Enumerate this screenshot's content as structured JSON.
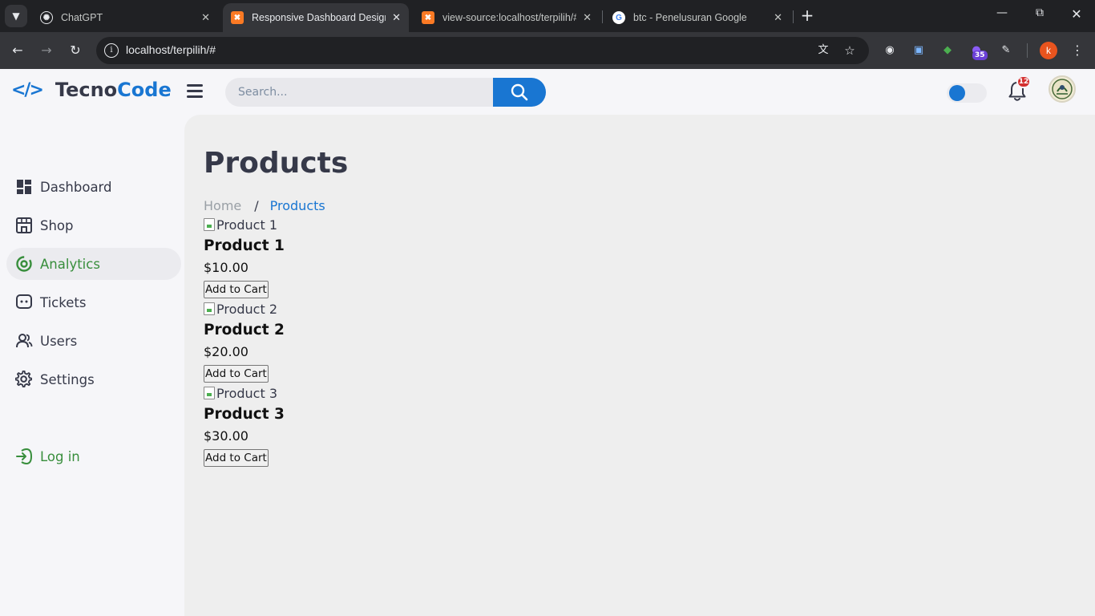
{
  "browser": {
    "tabs": [
      {
        "title": "ChatGPT",
        "icon": "chatgpt-icon",
        "active": false
      },
      {
        "title": "Responsive Dashboard Design #",
        "icon": "xampp-icon",
        "active": true
      },
      {
        "title": "view-source:localhost/terpilih/#",
        "icon": "xampp-icon",
        "active": false
      },
      {
        "title": "btc - Penelusuran Google",
        "icon": "google-icon",
        "active": false
      }
    ],
    "url": "localhost/terpilih/#",
    "extension_badge": "35",
    "profile_initial": "k"
  },
  "header": {
    "logo_prefix": "Tecno",
    "logo_accent": "Code",
    "search_placeholder": "Search...",
    "notification_count": "12",
    "colors": {
      "primary": "#1976d2",
      "success": "#388e3c",
      "danger": "#d32f2f",
      "text": "#363949"
    }
  },
  "sidebar": {
    "items": [
      {
        "label": "Dashboard",
        "icon": "dashboard-icon"
      },
      {
        "label": "Shop",
        "icon": "shop-icon"
      },
      {
        "label": "Analytics",
        "icon": "analytics-icon",
        "active": true
      },
      {
        "label": "Tickets",
        "icon": "tickets-icon"
      },
      {
        "label": "Users",
        "icon": "users-icon"
      },
      {
        "label": "Settings",
        "icon": "settings-icon"
      }
    ],
    "login_label": "Log in"
  },
  "main": {
    "title": "Products",
    "breadcrumb": {
      "home": "Home",
      "separator": "/",
      "current": "Products"
    },
    "products": [
      {
        "image_alt": "Product 1",
        "name": "Product 1",
        "price": "$10.00",
        "button": "Add to Cart"
      },
      {
        "image_alt": "Product 2",
        "name": "Product 2",
        "price": "$20.00",
        "button": "Add to Cart"
      },
      {
        "image_alt": "Product 3",
        "name": "Product 3",
        "price": "$30.00",
        "button": "Add to Cart"
      }
    ]
  }
}
